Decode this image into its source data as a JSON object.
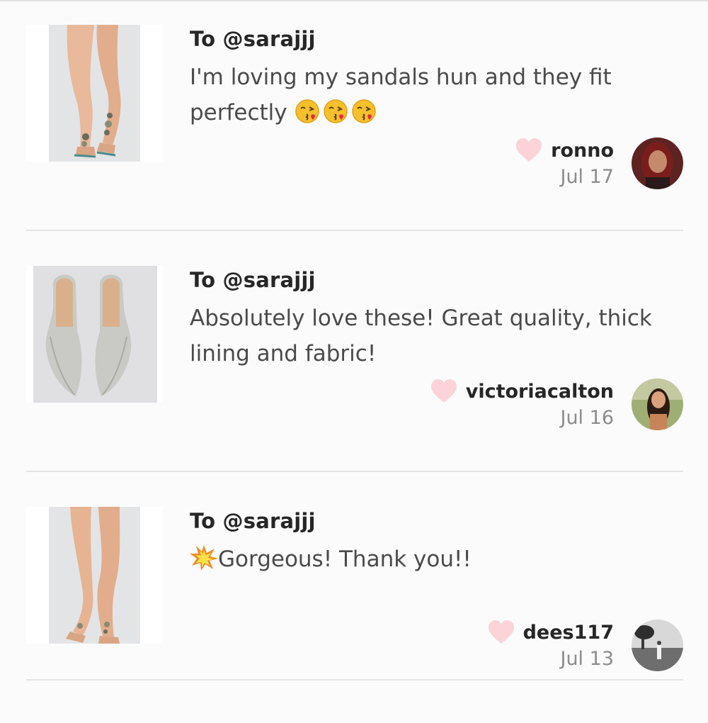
{
  "reviews": [
    {
      "to": "To @sarajjj",
      "message": "I'm loving my sandals hun and they fit perfectly",
      "emoji": [
        "kissing-face-emoji",
        "kissing-face-emoji",
        "kissing-face-emoji"
      ],
      "username": "ronno",
      "date": "Jul 17",
      "product": "sandals-product-image",
      "avatar": "ronno-avatar"
    },
    {
      "to": "To @sarajjj",
      "message": "Absolutely love these! Great quality, thick lining and fabric!",
      "emoji": [],
      "username": "victoriacalton",
      "date": "Jul 16",
      "product": "rhinestone-mules-product-image",
      "avatar": "victoriacalton-avatar"
    },
    {
      "to": "To @sarajjj",
      "message": "Gorgeous! Thank you!!",
      "emoji_prefix": "collision-emoji",
      "username": "dees117",
      "date": "Jul 13",
      "product": "sandals-product-image",
      "avatar": "dees117-avatar"
    }
  ],
  "colors": {
    "heart": "#fbd3d8",
    "text_dark": "#262626",
    "text_body": "#4a4a4a",
    "text_muted": "#8c8c8c",
    "divider": "#e4e4e4"
  }
}
